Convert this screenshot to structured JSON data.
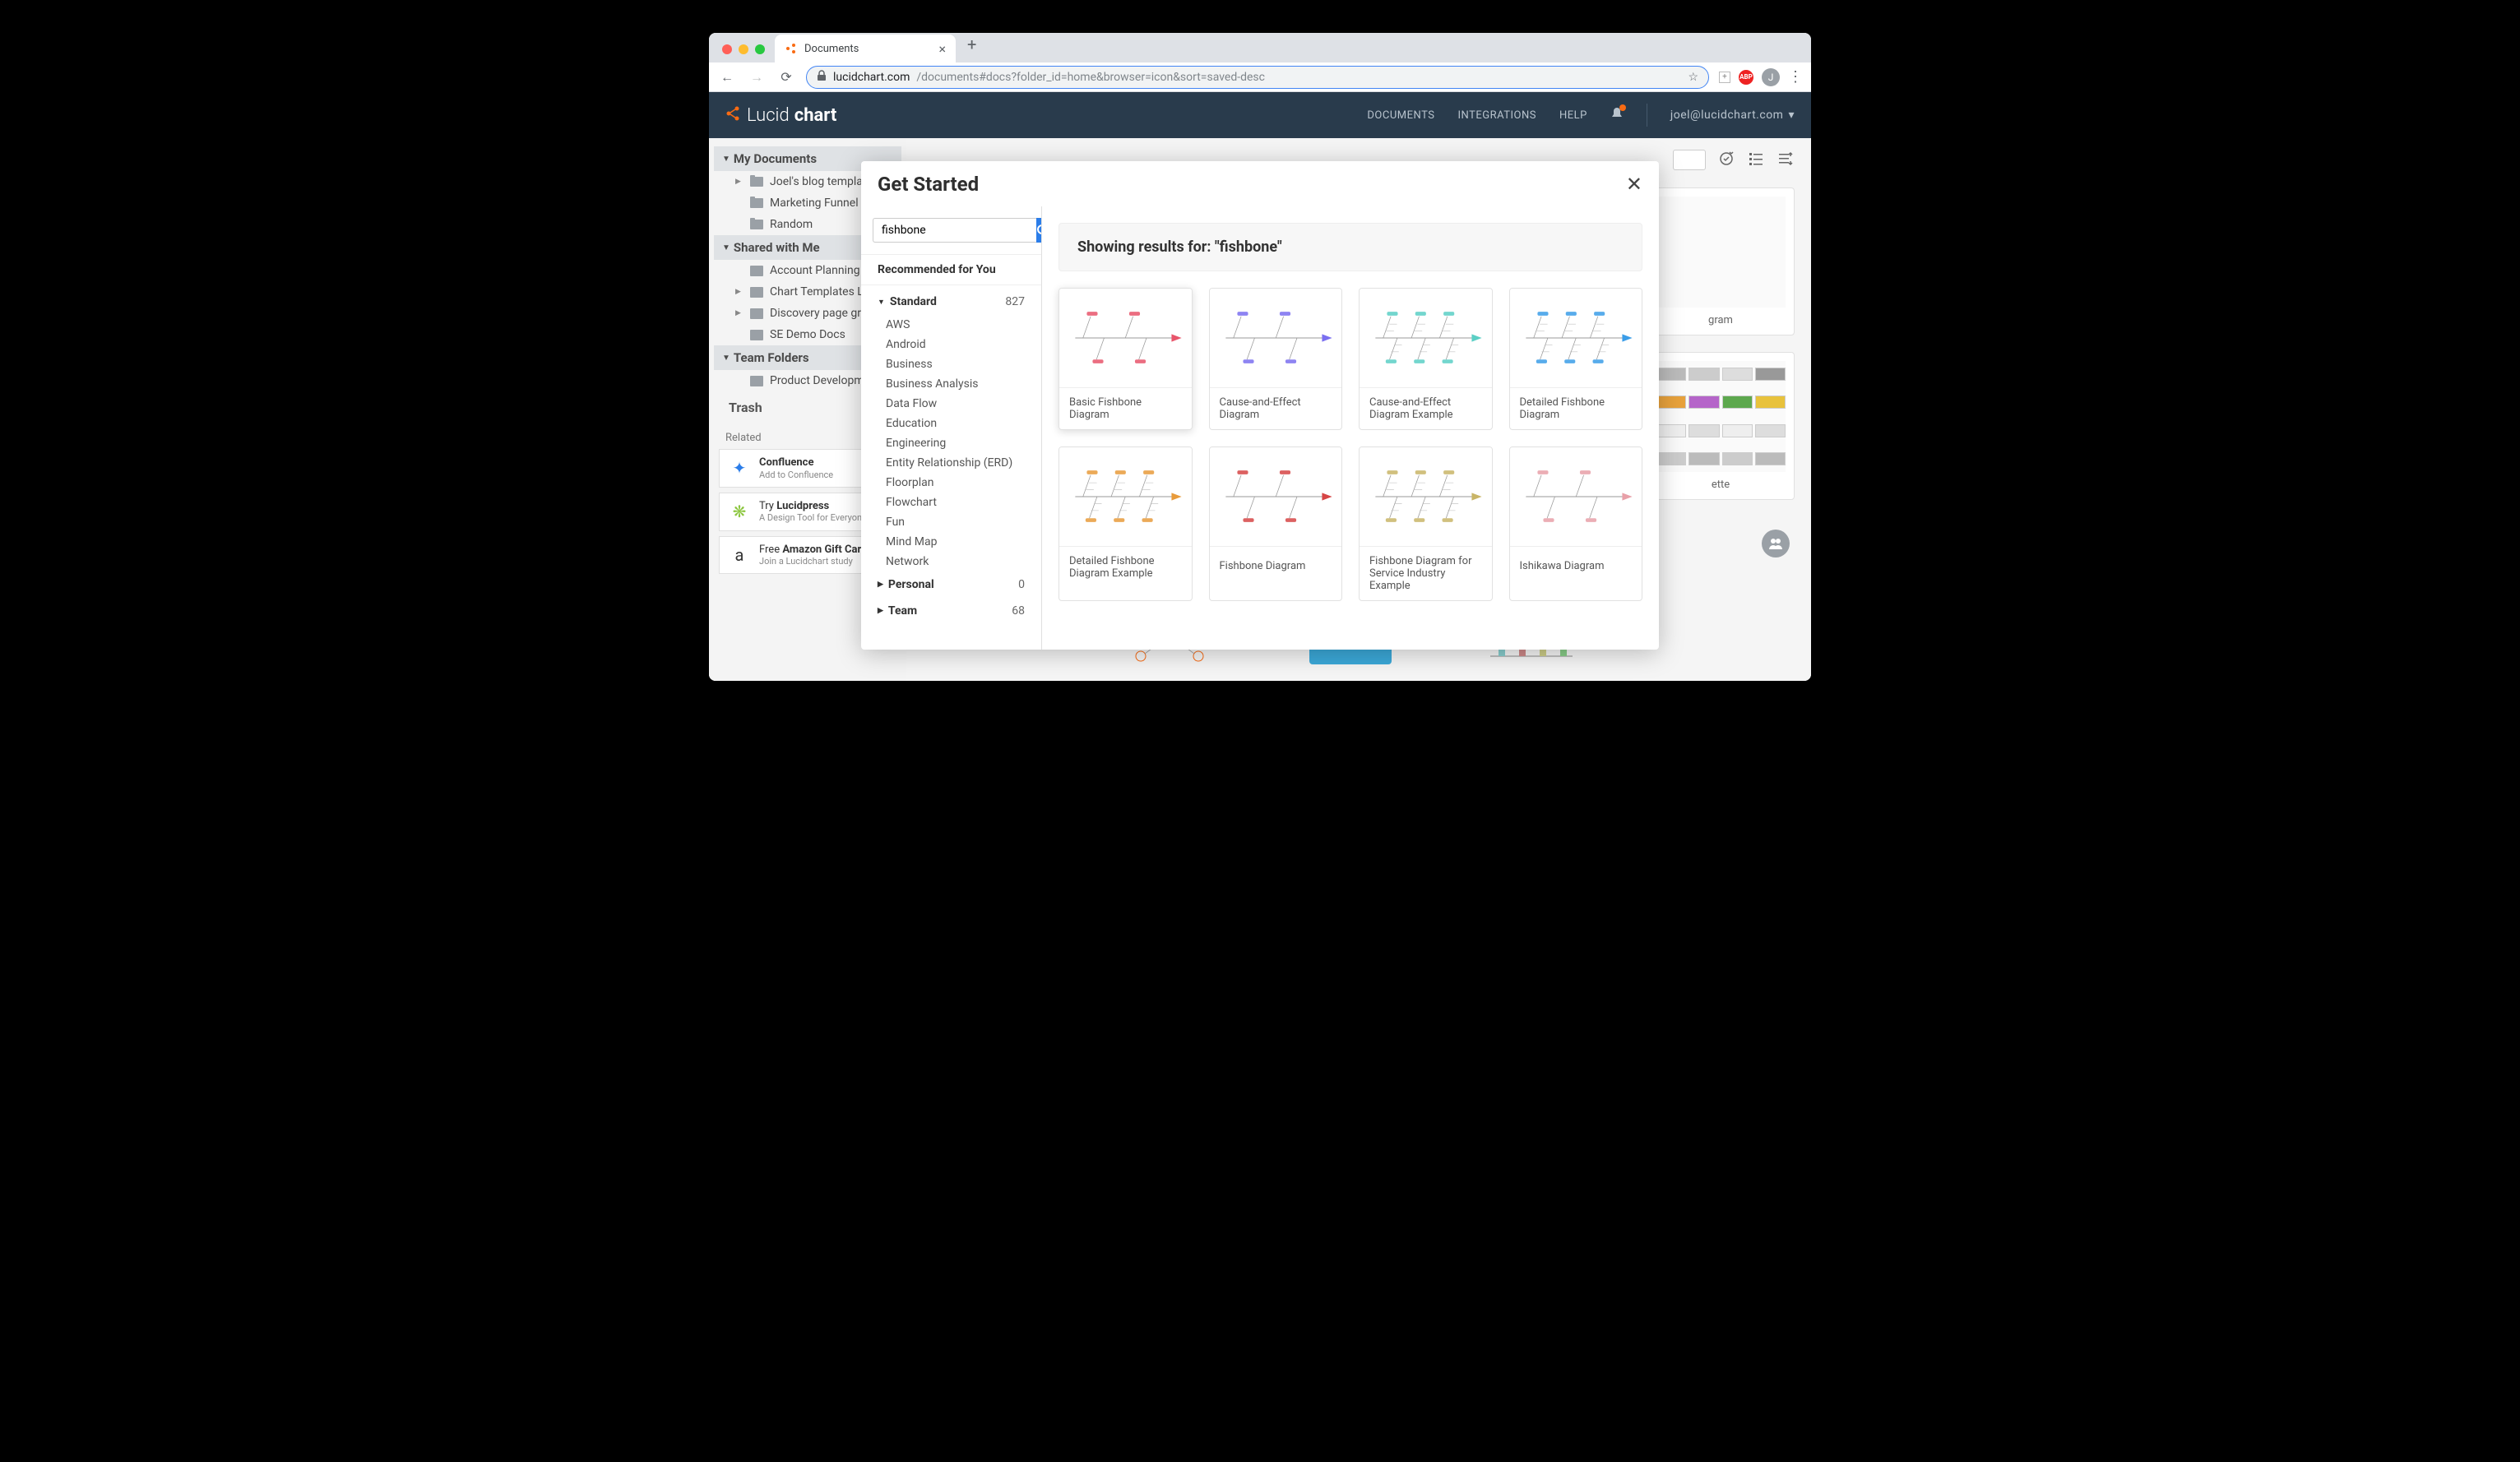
{
  "browser": {
    "tab_title": "Documents",
    "url_host": "lucidchart.com",
    "url_path": "/documents#docs?folder_id=home&browser=icon&sort=saved-desc",
    "avatar_letter": "J"
  },
  "header": {
    "logo_light": "Lucid",
    "logo_bold": "chart",
    "nav": [
      "DOCUMENTS",
      "INTEGRATIONS",
      "HELP"
    ],
    "user_email": "joel@lucidchart.com"
  },
  "sidebar": {
    "sections": [
      {
        "title": "My Documents",
        "items": [
          {
            "label": "Joel's blog templat",
            "icon": "folder",
            "caret": true
          },
          {
            "label": "Marketing Funnel E",
            "icon": "folder",
            "caret": false
          },
          {
            "label": "Random",
            "icon": "folder",
            "caret": false
          }
        ]
      },
      {
        "title": "Shared with Me",
        "items": [
          {
            "label": "Account Planning",
            "icon": "shared",
            "caret": false
          },
          {
            "label": "Chart Templates Li",
            "icon": "shared",
            "caret": true
          },
          {
            "label": "Discovery page gra",
            "icon": "shared",
            "caret": true
          },
          {
            "label": "SE Demo Docs",
            "icon": "shared",
            "caret": false
          }
        ]
      },
      {
        "title": "Team Folders",
        "items": [
          {
            "label": "Product Developme",
            "icon": "shared",
            "caret": false
          }
        ]
      }
    ],
    "trash": "Trash",
    "related_label": "Related",
    "related": [
      {
        "title": "Confluence",
        "sub": "Add to Confluence",
        "color": "#2b7de9"
      },
      {
        "title_prefix": "Try ",
        "title": "Lucidpress",
        "sub": "A Design Tool for Everyone",
        "color": "#8cc63f"
      },
      {
        "title_prefix": "Free ",
        "title": "Amazon Gift Car",
        "sub": "Join a Lucidchart study",
        "color": "#333"
      }
    ]
  },
  "bg_cards": {
    "card1": "gram",
    "card2": "ette"
  },
  "modal": {
    "title": "Get Started",
    "search_value": "fishbone",
    "recommended": "Recommended for You",
    "groups": [
      {
        "label": "Standard",
        "count": "827",
        "expanded": true,
        "items": [
          "AWS",
          "Android",
          "Business",
          "Business Analysis",
          "Data Flow",
          "Education",
          "Engineering",
          "Entity Relationship (ERD)",
          "Floorplan",
          "Flowchart",
          "Fun",
          "Mind Map",
          "Network"
        ]
      },
      {
        "label": "Personal",
        "count": "0",
        "expanded": false,
        "items": []
      },
      {
        "label": "Team",
        "count": "68",
        "expanded": false,
        "items": []
      }
    ],
    "results_label": "Showing results for: \"fishbone\"",
    "templates": [
      {
        "label": "Basic Fishbone Diagram",
        "color": "#e8556b"
      },
      {
        "label": "Cause-and-Effect Diagram",
        "color": "#7a6ff0"
      },
      {
        "label": "Cause-and-Effect Diagram Example",
        "color": "#5bcfc5"
      },
      {
        "label": "Detailed Fishbone Diagram",
        "color": "#3b9de8"
      },
      {
        "label": "Detailed Fishbone Diagram Example",
        "color": "#e89b3b"
      },
      {
        "label": "Fishbone Diagram",
        "color": "#d64545"
      },
      {
        "label": "Fishbone Diagram for Service Industry Example",
        "color": "#c9b567"
      },
      {
        "label": "Ishikawa Diagram",
        "color": "#e8a0a8"
      }
    ]
  }
}
